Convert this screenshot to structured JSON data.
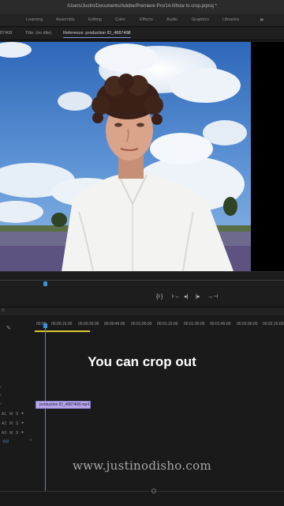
{
  "window": {
    "path": "/Users/Justin/Documents/Adobe/Premiere Pro/14.0/how to crop.prproj *"
  },
  "workspaces": {
    "tabs": [
      "Learning",
      "Assembly",
      "Editing",
      "Color",
      "Effects",
      "Audio",
      "Graphics",
      "Libraries"
    ],
    "more": "»"
  },
  "monitor": {
    "left_fragment": "87408",
    "title_label": "Title: (no title)",
    "reference_label": "Reference: production ID_4887408",
    "menu_glyph": "≡"
  },
  "transport": {
    "buttons": [
      "{⊦}",
      "⊦←",
      "◂|",
      "|▸",
      "→⊣"
    ]
  },
  "timeline": {
    "ruler": [
      "00:00",
      "00:00:15:00",
      "00:00:30:00",
      "00:00:45:00",
      "00:01:00:00",
      "00:01:15:00",
      "00:01:30:00",
      "00:01:45:00",
      "00:02:00:00",
      "00:02:15:00"
    ],
    "clip_name": "production ID_4887408.mp4",
    "audio_tracks": [
      {
        "name": "A1",
        "mute": "M",
        "solo": "S"
      },
      {
        "name": "A2",
        "mute": "M",
        "solo": "S"
      },
      {
        "name": "A3",
        "mute": "M",
        "solo": "S"
      }
    ],
    "master_value": "0.0",
    "icons": {
      "wrench": "wrench-icon",
      "mic": "microphone-icon"
    }
  },
  "overlay": {
    "caption": "You can crop out",
    "watermark": "www.justinodisho.com"
  },
  "colors": {
    "accent_blue": "#3e8fe0",
    "clip_purple": "#b6a6e8",
    "workarea_yellow": "#d9c531"
  }
}
